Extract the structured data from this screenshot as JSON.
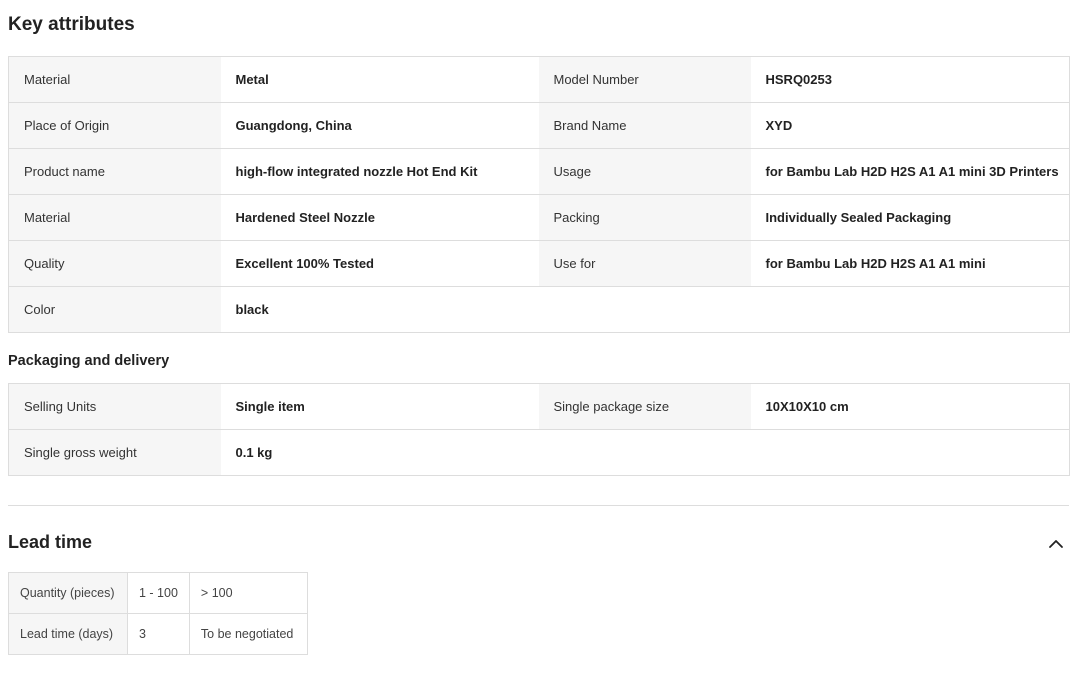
{
  "key_attributes": {
    "title": "Key attributes",
    "rows": [
      [
        {
          "k": "Material",
          "v": "Metal"
        },
        {
          "k": "Model Number",
          "v": "HSRQ0253"
        }
      ],
      [
        {
          "k": "Place of Origin",
          "v": "Guangdong, China"
        },
        {
          "k": "Brand Name",
          "v": "XYD"
        }
      ],
      [
        {
          "k": "Product name",
          "v": "high-flow integrated nozzle Hot End Kit"
        },
        {
          "k": "Usage",
          "v": "for Bambu Lab H2D H2S A1 A1 mini 3D Printers"
        }
      ],
      [
        {
          "k": "Material",
          "v": "Hardened Steel Nozzle"
        },
        {
          "k": "Packing",
          "v": "Individually Sealed Packaging"
        }
      ],
      [
        {
          "k": "Quality",
          "v": "Excellent 100% Tested"
        },
        {
          "k": "Use for",
          "v": "for Bambu Lab H2D H2S A1 A1 mini"
        }
      ],
      [
        {
          "k": "Color",
          "v": "black"
        },
        null
      ]
    ]
  },
  "packaging": {
    "title": "Packaging and delivery",
    "rows": [
      [
        {
          "k": "Selling Units",
          "v": "Single item"
        },
        {
          "k": "Single package size",
          "v": "10X10X10 cm"
        }
      ],
      [
        {
          "k": "Single gross weight",
          "v": "0.1 kg"
        },
        null
      ]
    ]
  },
  "lead_time": {
    "title": "Lead time",
    "collapse_icon": "chevron-up-icon",
    "quantity_label": "Quantity (pieces)",
    "quantity_ranges": [
      "1 - 100",
      "> 100"
    ],
    "days_label": "Lead time (days)",
    "days_values": [
      "3",
      "To be negotiated"
    ]
  }
}
